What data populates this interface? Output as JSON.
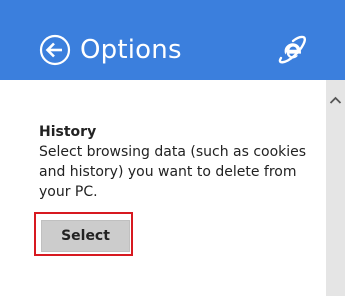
{
  "header": {
    "title": "Options",
    "background_color": "#3b7fdd",
    "back_icon": "back-arrow-circle-icon",
    "logo_icon": "internet-explorer-logo-icon"
  },
  "history": {
    "heading": "History",
    "description": "Select browsing data (such as cookies and history) you want to delete from your PC.",
    "select_label": "Select"
  },
  "highlight_color": "#d71920",
  "scrollbar": {
    "up_icon": "chevron-up-icon"
  }
}
